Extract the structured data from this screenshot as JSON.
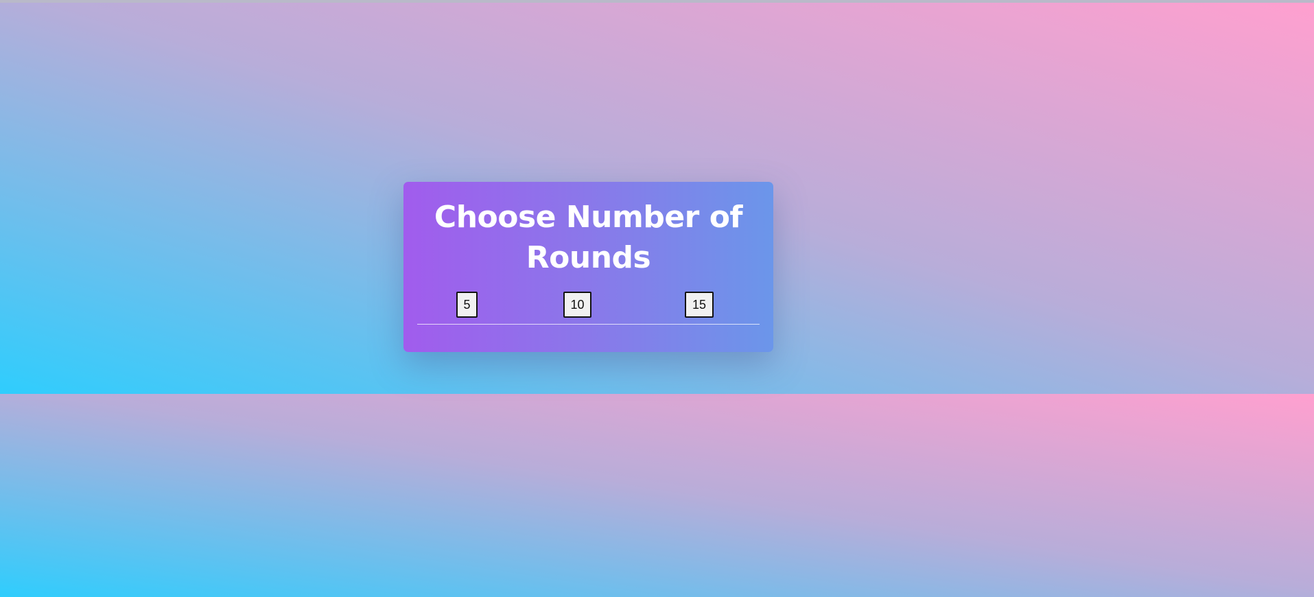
{
  "dialog": {
    "title": "Choose Number of Rounds",
    "options": [
      {
        "label": "5"
      },
      {
        "label": "10"
      },
      {
        "label": "15"
      }
    ]
  },
  "colors": {
    "background_gradient": [
      "#2fcdfd",
      "#b8add9",
      "#ffa0cf"
    ],
    "dialog_gradient": [
      "#a15ced",
      "#8a78ea",
      "#6b96ea"
    ],
    "title_text": "#ffffff",
    "button_background": "#f1f1f1",
    "button_border": "#111111"
  }
}
